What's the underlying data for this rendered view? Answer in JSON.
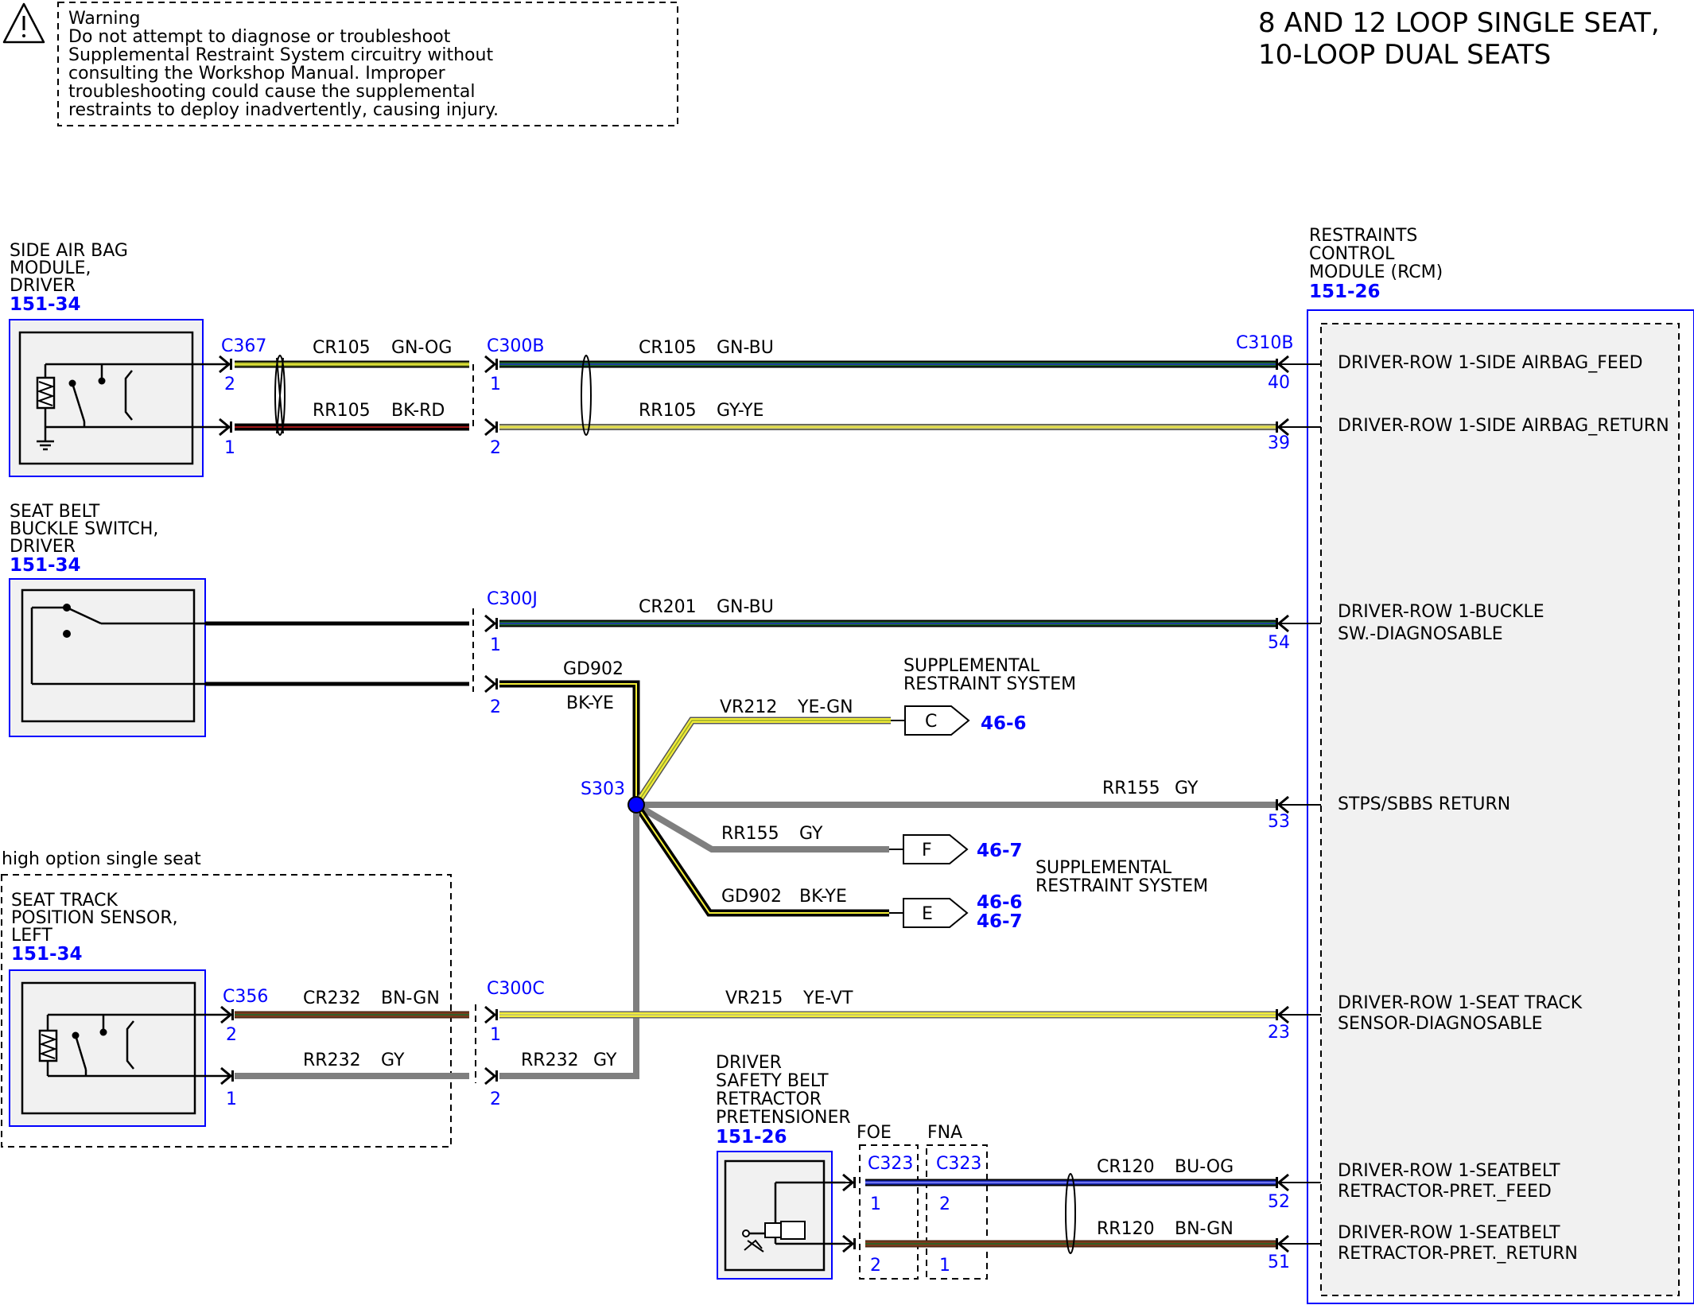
{
  "title": {
    "line1": "8 AND 12 LOOP SINGLE SEAT,",
    "line2": "10-LOOP DUAL SEATS"
  },
  "warning": {
    "icon": "warning-triangle-icon",
    "lines": [
      "Warning",
      "Do not attempt to diagnose or troubleshoot",
      "Supplemental Restraint System circuitry without",
      "consulting the Workshop Manual. Improper",
      "troubleshooting could cause the supplemental",
      "restraints to deploy inadvertently, causing injury."
    ]
  },
  "components": {
    "side_airbag": {
      "lines": [
        "SIDE AIR BAG",
        "MODULE,",
        "DRIVER"
      ],
      "ref": "151-34"
    },
    "buckle_switch": {
      "lines": [
        "SEAT BELT",
        "BUCKLE SWITCH,",
        "DRIVER"
      ],
      "ref": "151-34"
    },
    "seat_track": {
      "lines": [
        "SEAT TRACK",
        "POSITION SENSOR,",
        "LEFT"
      ],
      "ref": "151-34"
    },
    "pretensioner": {
      "lines": [
        "DRIVER",
        "SAFETY BELT",
        "RETRACTOR",
        "PRETENSIONER"
      ],
      "ref": "151-26"
    },
    "rcm": {
      "lines": [
        "RESTRAINTS",
        "CONTROL",
        "MODULE (RCM)"
      ],
      "ref": "151-26"
    }
  },
  "option_label": "high option single seat",
  "option_codes": {
    "foe": "FOE",
    "fna": "FNA"
  },
  "connectors": {
    "c367": "C367",
    "c300b": "C300B",
    "c310b": "C310B",
    "c300j": "C300J",
    "c356": "C356",
    "c300c": "C300C",
    "c323a": "C323",
    "c323b": "C323",
    "splice": "S303"
  },
  "pins": {
    "c367_top": "2",
    "c367_bot": "1",
    "c300b_top": "1",
    "c300b_bot": "2",
    "rcm_40": "40",
    "rcm_39": "39",
    "c300j_top": "1",
    "c300j_bot": "2",
    "rcm_54": "54",
    "rcm_53": "53",
    "c356_top": "2",
    "c356_bot": "1",
    "c300c_top": "1",
    "c300c_bot": "2",
    "rcm_23": "23",
    "c323a_top": "1",
    "c323a_bot": "2",
    "c323b_top": "2",
    "c323b_bot": "1",
    "rcm_52": "52",
    "rcm_51": "51"
  },
  "wires": {
    "w1": {
      "circuit": "CR105",
      "color": "GN-OG"
    },
    "w2": {
      "circuit": "RR105",
      "color": "BK-RD"
    },
    "w3": {
      "circuit": "CR105",
      "color": "GN-BU"
    },
    "w4": {
      "circuit": "RR105",
      "color": "GY-YE"
    },
    "w5": {
      "circuit": "CR201",
      "color": "GN-BU"
    },
    "w6": {
      "circuit": "GD902",
      "color": "BK-YE"
    },
    "w7": {
      "circuit": "VR212",
      "color": "YE-GN"
    },
    "w8": {
      "circuit": "RR155",
      "color": "GY"
    },
    "w9": {
      "circuit": "RR155",
      "color": "GY"
    },
    "w10": {
      "circuit": "GD902",
      "color": "BK-YE"
    },
    "w11": {
      "circuit": "CR232",
      "color": "BN-GN"
    },
    "w12": {
      "circuit": "RR232",
      "color": "GY"
    },
    "w13": {
      "circuit": "VR215",
      "color": "YE-VT"
    },
    "w14": {
      "circuit": "RR232",
      "color": "GY"
    },
    "w15": {
      "circuit": "CR120",
      "color": "BU-OG"
    },
    "w16": {
      "circuit": "RR120",
      "color": "BN-GN"
    }
  },
  "offpage": {
    "c": {
      "letter": "C",
      "refs": [
        "46-6"
      ]
    },
    "f": {
      "letter": "F",
      "refs": [
        "46-7"
      ]
    },
    "e": {
      "letter": "E",
      "refs": [
        "46-6",
        "46-7"
      ]
    }
  },
  "srs_labels": {
    "upper": [
      "SUPPLEMENTAL",
      "RESTRAINT SYSTEM"
    ],
    "lower": [
      "SUPPLEMENTAL",
      "RESTRAINT SYSTEM"
    ]
  },
  "rcm_pins": {
    "p40": [
      "DRIVER-ROW 1-SIDE AIRBAG_FEED"
    ],
    "p39": [
      "DRIVER-ROW 1-SIDE AIRBAG_RETURN"
    ],
    "p54": [
      "DRIVER-ROW 1-BUCKLE",
      "SW.-DIAGNOSABLE"
    ],
    "p53": [
      "STPS/SBBS RETURN"
    ],
    "p23": [
      "DRIVER-ROW 1-SEAT TRACK",
      "SENSOR-DIAGNOSABLE"
    ],
    "p52": [
      "DRIVER-ROW 1-SEATBELT",
      "RETRACTOR-PRET._FEED"
    ],
    "p51": [
      "DRIVER-ROW 1-SEATBELT",
      "RETRACTOR-PRET._RETURN"
    ]
  },
  "wire_colors": {
    "green": "#1d6b2a",
    "blue": "#1f2fbf",
    "yellow": "#f3ee38",
    "olive": "#9aa82b",
    "black": "#000000",
    "red": "#a01818",
    "brown": "#7a3a1c",
    "gray": "#7f7f7f",
    "gyye": "#bdbb72",
    "splice": "#0000ff"
  }
}
